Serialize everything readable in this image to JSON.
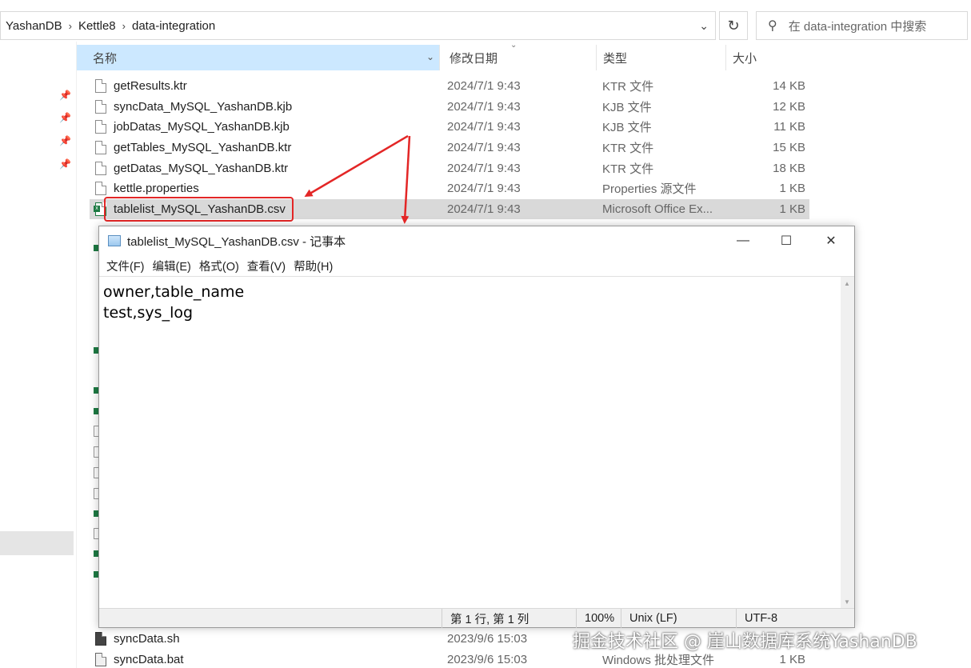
{
  "address": {
    "crumbs": [
      "YashanDB",
      "Kettle8",
      "data-integration"
    ],
    "separator": "›"
  },
  "search": {
    "placeholder": "在 data-integration 中搜索"
  },
  "columns": {
    "name": "名称",
    "date": "修改日期",
    "type": "类型",
    "size": "大小"
  },
  "files": [
    {
      "name": "getResults.ktr",
      "date": "2024/7/1 9:43",
      "type": "KTR 文件",
      "size": "14 KB"
    },
    {
      "name": "syncData_MySQL_YashanDB.kjb",
      "date": "2024/7/1 9:43",
      "type": "KJB 文件",
      "size": "12 KB"
    },
    {
      "name": "jobDatas_MySQL_YashanDB.kjb",
      "date": "2024/7/1 9:43",
      "type": "KJB 文件",
      "size": "11 KB"
    },
    {
      "name": "getTables_MySQL_YashanDB.ktr",
      "date": "2024/7/1 9:43",
      "type": "KTR 文件",
      "size": "15 KB"
    },
    {
      "name": "getDatas_MySQL_YashanDB.ktr",
      "date": "2024/7/1 9:43",
      "type": "KTR 文件",
      "size": "18 KB"
    },
    {
      "name": "kettle.properties",
      "date": "2024/7/1 9:43",
      "type": "Properties 源文件",
      "size": "1 KB"
    },
    {
      "name": "tablelist_MySQL_YashanDB.csv",
      "date": "2024/7/1 9:43",
      "type": "Microsoft Office Ex...",
      "size": "1 KB"
    }
  ],
  "bottom_files": [
    {
      "name": "syncData.sh",
      "date": "2023/9/6 15:03",
      "type": "",
      "size": ""
    },
    {
      "name": "syncData.bat",
      "date": "2023/9/6 15:03",
      "type": "Windows 批处理文件",
      "size": "1 KB"
    }
  ],
  "notepad": {
    "title": "tablelist_MySQL_YashanDB.csv - 记事本",
    "menu": [
      "文件(F)",
      "编辑(E)",
      "格式(O)",
      "查看(V)",
      "帮助(H)"
    ],
    "content": "owner,table_name\ntest,sys_log",
    "status": {
      "position": "第 1 行, 第 1 列",
      "zoom": "100%",
      "eol": "Unix (LF)",
      "encoding": "UTF-8"
    }
  },
  "watermark": "掘金技术社区 @ 崖山数据库系统YashanDB",
  "colors": {
    "highlight": "#e32626",
    "header_selected": "#cce8ff",
    "row_selected": "#d9d9d9"
  }
}
